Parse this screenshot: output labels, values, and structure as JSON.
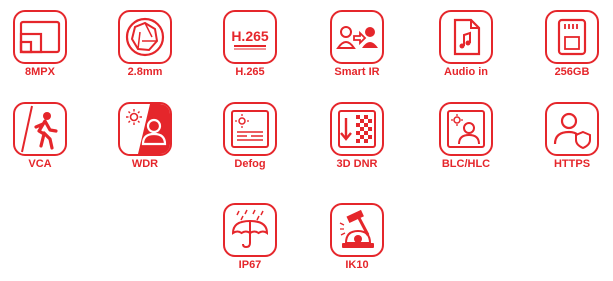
{
  "accent_color": "#e5262b",
  "features": [
    {
      "label": "8MPX",
      "icon": "resolution-icon"
    },
    {
      "label": "2.8mm",
      "icon": "lens-aperture-icon"
    },
    {
      "label": "H.265",
      "icon": "codec-icon",
      "icon_text": "H.265"
    },
    {
      "label": "Smart IR",
      "icon": "smart-ir-icon"
    },
    {
      "label": "Audio in",
      "icon": "audio-file-icon"
    },
    {
      "label": "256GB",
      "icon": "sd-card-icon"
    },
    {
      "label": "VCA",
      "icon": "intrusion-detection-icon"
    },
    {
      "label": "WDR",
      "icon": "wide-dynamic-range-icon"
    },
    {
      "label": "Defog",
      "icon": "defog-icon"
    },
    {
      "label": "3D DNR",
      "icon": "noise-reduction-icon"
    },
    {
      "label": "BLC/HLC",
      "icon": "backlight-compensation-icon"
    },
    {
      "label": "HTTPS",
      "icon": "secure-user-icon"
    },
    {
      "label": "IP67",
      "icon": "weatherproof-umbrella-icon"
    },
    {
      "label": "IK10",
      "icon": "vandal-proof-hammer-icon"
    }
  ]
}
